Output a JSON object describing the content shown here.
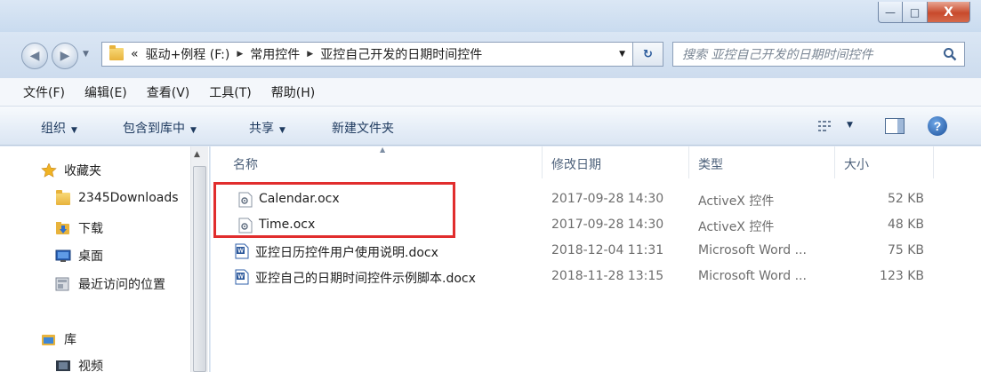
{
  "window": {
    "minimize": "—",
    "maximize": "□",
    "close": "X"
  },
  "address_bar": {
    "prefix": "«",
    "crumbs": [
      "驱动+例程 (F:)",
      "常用控件",
      "亚控自己开发的日期时间控件"
    ]
  },
  "search": {
    "placeholder": "搜索 亚控自己开发的日期时间控件"
  },
  "menu": [
    "文件(F)",
    "编辑(E)",
    "查看(V)",
    "工具(T)",
    "帮助(H)"
  ],
  "commands": {
    "organize": "组织",
    "include_library": "包含到库中",
    "share": "共享",
    "new_folder": "新建文件夹",
    "help": "?"
  },
  "nav_pane": {
    "favorites": "收藏夹",
    "items": [
      "2345Downloads",
      "下载",
      "桌面",
      "最近访问的位置"
    ],
    "libraries": "库",
    "library_items": [
      "视频"
    ]
  },
  "columns": {
    "name": "名称",
    "modified": "修改日期",
    "type": "类型",
    "size": "大小"
  },
  "files": [
    {
      "name": "Calendar.ocx",
      "modified": "2017-09-28 14:30",
      "type": "ActiveX 控件",
      "size": "52 KB",
      "icon": "activex-file-icon"
    },
    {
      "name": "Time.ocx",
      "modified": "2017-09-28 14:30",
      "type": "ActiveX 控件",
      "size": "48 KB",
      "icon": "activex-file-icon"
    },
    {
      "name": "亚控日历控件用户使用说明.docx",
      "modified": "2018-12-04 11:31",
      "type": "Microsoft Word ...",
      "size": "75 KB",
      "icon": "word-document-icon"
    },
    {
      "name": "亚控自己的日期时间控件示例脚本.docx",
      "modified": "2018-11-28 13:15",
      "type": "Microsoft Word ...",
      "size": "123 KB",
      "icon": "word-document-icon"
    }
  ],
  "colors": {
    "highlight": "#e12d2d",
    "accent": "#2b5b9c"
  }
}
